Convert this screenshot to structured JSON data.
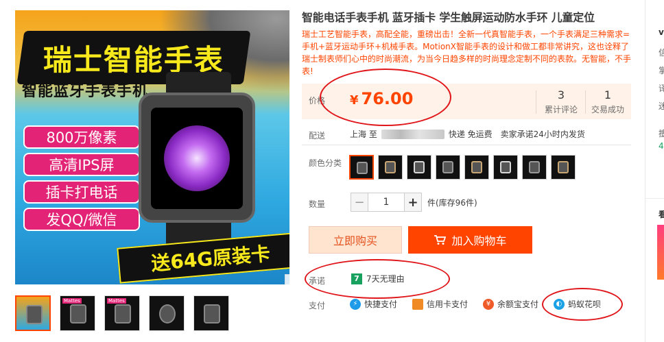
{
  "gallery": {
    "title_banner": "瑞士智能手表",
    "subtitle": "智能蓝牙手表手机",
    "features": [
      "800万像素",
      "高清IPS屏",
      "插卡打电话",
      "发QQ/微信"
    ],
    "promo": "送64G原装卡",
    "thumb_tag": "Mattes"
  },
  "product": {
    "title": "智能电话手表手机 蓝牙插卡 学生触屏运动防水手环 儿童定位",
    "description": "瑞士工艺智能手表，高配全能，重磅出击！全新一代真智能手表，一个手表满足三种需求=手机+蓝牙运动手环+机械手表。MotionX智能手表的设计和做工都非常讲究，这也诠释了瑞士制表师们心中的时尚潮流，为当今日趋多样的时尚理念定制不同的表款。无智能，不手表!"
  },
  "price": {
    "label": "价格",
    "currency": "¥",
    "value": "76.00",
    "reviews_count": "3",
    "reviews_label": "累计评论",
    "sales_count": "1",
    "sales_label": "交易成功"
  },
  "shipping": {
    "label": "配送",
    "from": "上海 至",
    "fee": "快递 免运费",
    "promise": "卖家承诺24小时内发货"
  },
  "options": {
    "color_label": "颜色分类"
  },
  "quantity": {
    "label": "数量",
    "value": "1",
    "minus": "−",
    "plus": "+",
    "stock": "件(库存96件)"
  },
  "actions": {
    "buy_now": "立即购买",
    "add_to_cart": "加入购物车"
  },
  "promise": {
    "label": "承诺",
    "badge": "7",
    "text": "7天无理由"
  },
  "payment": {
    "label": "支付",
    "methods": [
      "快捷支付",
      "信用卡支付",
      "余额宝支付",
      "蚂蚁花呗"
    ]
  },
  "sidebar": {
    "chars": [
      "v",
      "信",
      "掌",
      "译",
      "迷",
      "擅",
      "4",
      "看"
    ]
  },
  "colors": {
    "accent": "#ff4400",
    "annotation": "#e0161b",
    "price_bg": "#fff2e8"
  }
}
